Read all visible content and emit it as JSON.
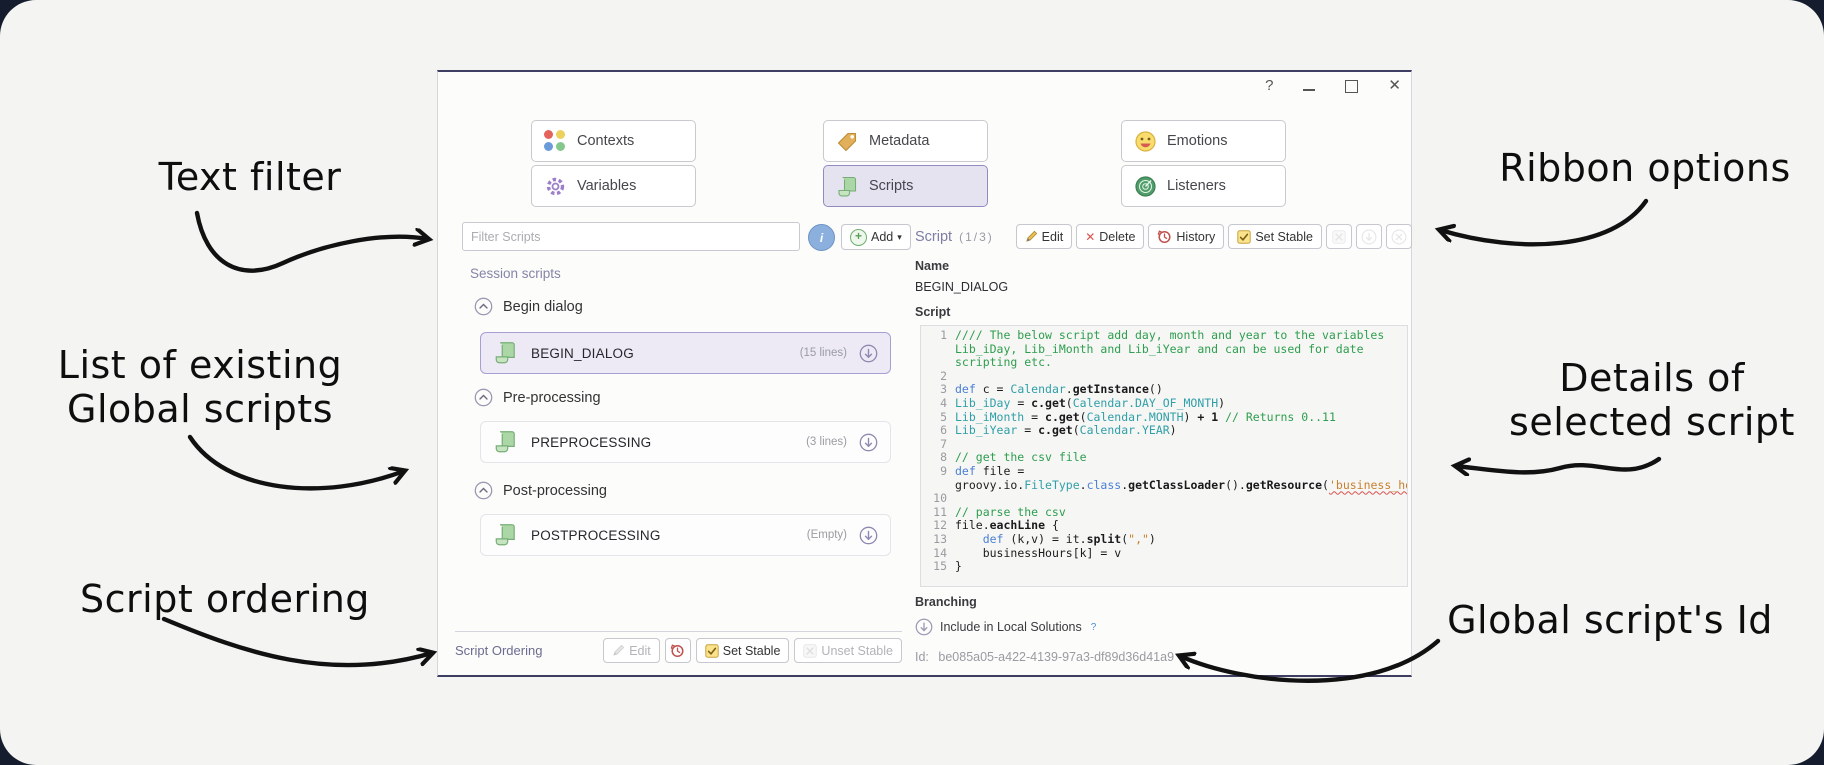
{
  "annotations": {
    "text_filter": "Text filter",
    "list_line1": "List of existing",
    "list_line2": "Global scripts",
    "script_ordering": "Script ordering",
    "ribbon_options": "Ribbon options",
    "details_line1": "Details of",
    "details_line2": "selected script",
    "global_id": "Global script's Id"
  },
  "icons": {
    "help": "?",
    "close": "✕",
    "info": "i",
    "plus": "+",
    "caret_down": "▾",
    "delete_x": "✕"
  },
  "ribbon": {
    "buttons": [
      {
        "label": "Contexts"
      },
      {
        "label": "Variables"
      },
      {
        "label": "Metadata"
      },
      {
        "label": "Scripts",
        "selected": true
      },
      {
        "label": "Emotions"
      },
      {
        "label": "Listeners"
      }
    ]
  },
  "left_panel": {
    "filter_placeholder": "Filter Scripts",
    "add_label": "Add",
    "section_title": "Session scripts",
    "groups": [
      {
        "title": "Begin dialog",
        "item": {
          "name": "BEGIN_DIALOG",
          "meta": "(15 lines)"
        }
      },
      {
        "title": "Pre-processing",
        "item": {
          "name": "PREPROCESSING",
          "meta": "(3 lines)"
        }
      },
      {
        "title": "Post-processing",
        "item": {
          "name": "POSTPROCESSING",
          "meta": "(Empty)"
        }
      }
    ],
    "ordering": {
      "label": "Script Ordering",
      "edit": "Edit",
      "set_stable": "Set Stable",
      "unset_stable": "Unset Stable"
    }
  },
  "detail_panel": {
    "title": "Script",
    "counter": "(1/3)",
    "toolbar": {
      "edit": "Edit",
      "delete": "Delete",
      "history": "History",
      "set_stable": "Set Stable"
    },
    "name_label": "Name",
    "name_value": "BEGIN_DIALOG",
    "script_label": "Script",
    "branching_label": "Branching",
    "include_label": "Include in Local Solutions",
    "help_mark": "?",
    "id_label": "Id:",
    "id_value": "be085a05-a422-4139-97a3-df89d36d41a9"
  },
  "script_editor": {
    "lines": [
      {
        "n": "1",
        "spans": [
          {
            "c": "com",
            "t": "//// The below script add day, month and year to the variables Lib_iDay, Lib_iMonth and Lib_iYear and can be used for date scripting etc."
          }
        ]
      },
      {
        "n": "2",
        "spans": []
      },
      {
        "n": "3",
        "spans": [
          {
            "c": "kw",
            "t": "def"
          },
          {
            "c": "pl",
            "t": " c = "
          },
          {
            "c": "cls",
            "t": "Calendar"
          },
          {
            "c": "pl",
            "t": "."
          },
          {
            "c": "m",
            "t": "getInstance"
          },
          {
            "c": "pl",
            "t": "()"
          }
        ]
      },
      {
        "n": "4",
        "spans": [
          {
            "c": "cls",
            "t": "Lib_iDay"
          },
          {
            "c": "pl",
            "t": " = "
          },
          {
            "c": "m",
            "t": "c.get"
          },
          {
            "c": "pl",
            "t": "("
          },
          {
            "c": "cls",
            "t": "Calendar.DAY_OF_MONTH"
          },
          {
            "c": "pl",
            "t": ")"
          }
        ]
      },
      {
        "n": "5",
        "spans": [
          {
            "c": "cls",
            "t": "Lib_iMonth"
          },
          {
            "c": "pl",
            "t": " = "
          },
          {
            "c": "m",
            "t": "c.get"
          },
          {
            "c": "pl",
            "t": "("
          },
          {
            "c": "cls",
            "t": "Calendar.MONTH"
          },
          {
            "c": "pl",
            "t": ") "
          },
          {
            "c": "m",
            "t": "+ 1"
          },
          {
            "c": "pl",
            "t": " "
          },
          {
            "c": "com",
            "t": "// Returns 0..11"
          }
        ]
      },
      {
        "n": "6",
        "spans": [
          {
            "c": "cls",
            "t": "Lib_iYear"
          },
          {
            "c": "pl",
            "t": " = "
          },
          {
            "c": "m",
            "t": "c.get"
          },
          {
            "c": "pl",
            "t": "("
          },
          {
            "c": "cls",
            "t": "Calendar.YEAR"
          },
          {
            "c": "pl",
            "t": ")"
          }
        ]
      },
      {
        "n": "7",
        "spans": []
      },
      {
        "n": "8",
        "spans": [
          {
            "c": "com",
            "t": "// get the csv file"
          }
        ]
      },
      {
        "n": "9",
        "spans": [
          {
            "c": "kw",
            "t": "def"
          },
          {
            "c": "pl",
            "t": " file = groovy.io."
          },
          {
            "c": "cls",
            "t": "FileType"
          },
          {
            "c": "pl",
            "t": "."
          },
          {
            "c": "kw",
            "t": "class"
          },
          {
            "c": "pl",
            "t": "."
          },
          {
            "c": "m",
            "t": "getClassLoader"
          },
          {
            "c": "pl",
            "t": "()."
          },
          {
            "c": "m",
            "t": "getResource"
          },
          {
            "c": "pl",
            "t": "("
          },
          {
            "c": "spell",
            "t": "'business_hours.csv'"
          },
          {
            "c": "pl",
            "t": ")"
          }
        ]
      },
      {
        "n": "10",
        "spans": []
      },
      {
        "n": "11",
        "spans": [
          {
            "c": "com",
            "t": "// parse the csv"
          }
        ]
      },
      {
        "n": "12",
        "spans": [
          {
            "c": "pl",
            "t": "file."
          },
          {
            "c": "m",
            "t": "eachLine"
          },
          {
            "c": "pl",
            "t": " {"
          }
        ]
      },
      {
        "n": "13",
        "spans": [
          {
            "c": "pl",
            "t": "    "
          },
          {
            "c": "kw",
            "t": "def"
          },
          {
            "c": "pl",
            "t": " (k,v) = it."
          },
          {
            "c": "m",
            "t": "split"
          },
          {
            "c": "pl",
            "t": "("
          },
          {
            "c": "str",
            "t": "\",\""
          },
          {
            "c": "pl",
            "t": ")"
          }
        ]
      },
      {
        "n": "14",
        "spans": [
          {
            "c": "pl",
            "t": "    businessHours[k] = v"
          }
        ]
      },
      {
        "n": "15",
        "spans": [
          {
            "c": "pl",
            "t": "}"
          }
        ]
      }
    ]
  },
  "colors": {
    "window_edge": "#3e3e63",
    "selected_bg": "#edeaf6",
    "selected_border": "#a79ed3",
    "comment_green": "#2e9e4e",
    "keyword_blue": "#4a7fd4",
    "class_teal": "#2f9fa8",
    "string_orange": "#c9802e",
    "annotation_ink": "#0e0e0e"
  }
}
